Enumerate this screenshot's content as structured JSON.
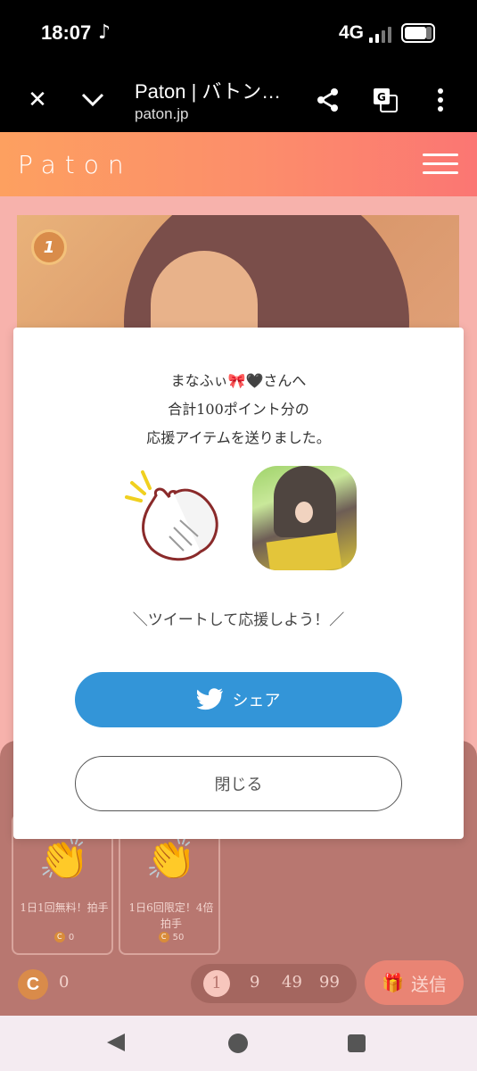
{
  "status_bar": {
    "time": "18:07",
    "network": "4G"
  },
  "browser": {
    "title": "Paton | バトン…",
    "url": "paton.jp"
  },
  "site": {
    "logo": "Paton"
  },
  "hero": {
    "rank": "1"
  },
  "modal": {
    "line1": "まなふぃ🎀🖤さんへ",
    "line2": "合計100ポイント分の",
    "line3": "応援アイテムを送りました。",
    "cta": "＼ツイートして応援しよう！／",
    "share_label": "シェア",
    "close_label": "閉じる"
  },
  "items": [
    {
      "label": "1日1回無料！拍手",
      "cost": "0",
      "icon": "clap-pink-icon"
    },
    {
      "label": "1日6回限定！4倍拍手",
      "cost": "50",
      "icon": "clap-orange-icon"
    }
  ],
  "footer": {
    "coin_symbol": "C",
    "coin_count": "0",
    "quantities": [
      "1",
      "9",
      "49",
      "99"
    ],
    "selected_quantity": "1",
    "send_label": "送信"
  },
  "colors": {
    "header_start": "#fda060",
    "header_end": "#fb7673",
    "share": "#3395d8",
    "overlay_bg": "#f7b2ac"
  }
}
